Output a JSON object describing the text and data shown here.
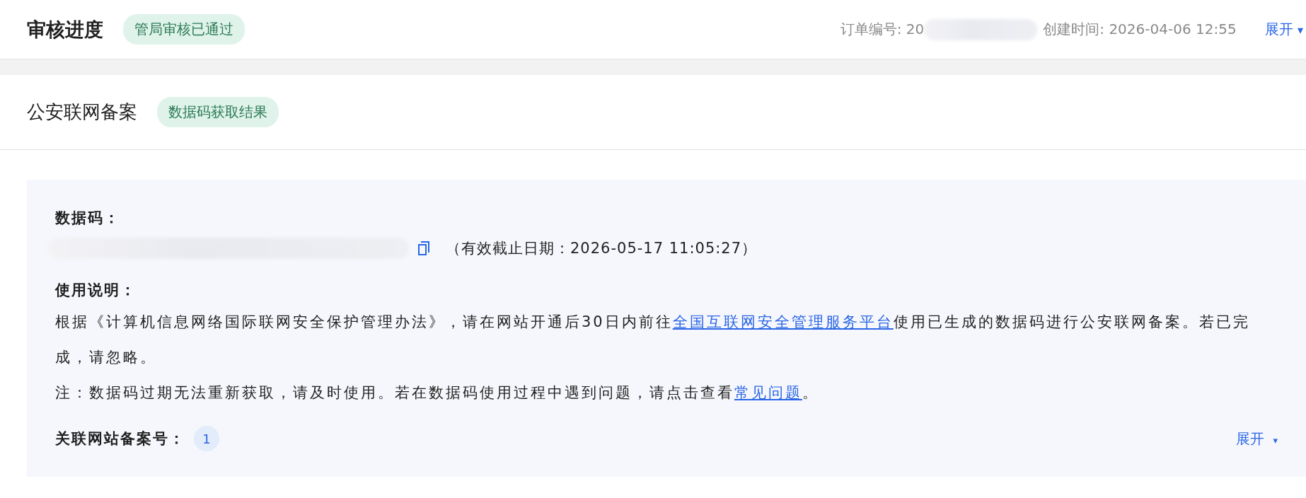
{
  "header": {
    "title": "审核进度",
    "badge": "管局审核已通过",
    "order_label": "订单编号: 20",
    "order_redacted": true,
    "created": "创建时间: 2026-04-06 12:55",
    "expand": "展开",
    "expand_caret": "▾"
  },
  "section": {
    "title": "公安联网备案",
    "badge": "数据码获取结果"
  },
  "panel": {
    "code_label": "数据码：",
    "code_redacted": true,
    "expiry": "（有效截止日期：2026-05-17 11:05:27）",
    "usage_label": "使用说明：",
    "paragraphs": [
      {
        "before": "根据《计算机信息网络国际联网安全保护管理办法》，请在网站开通后30日内前往",
        "link": "全国互联网安全管理服务平台",
        "after": "使用已生成的数据码进行公安联网备案。若已完成，请忽略。"
      },
      {
        "before": "注：数据码过期无法重新获取，请及时使用。若在数据码使用过程中遇到问题，请点击查看",
        "link": "常见问题",
        "after": "。"
      }
    ],
    "related_label": "关联网站备案号：",
    "related_count": "1",
    "expand": "展开",
    "expand_caret": "▾"
  }
}
